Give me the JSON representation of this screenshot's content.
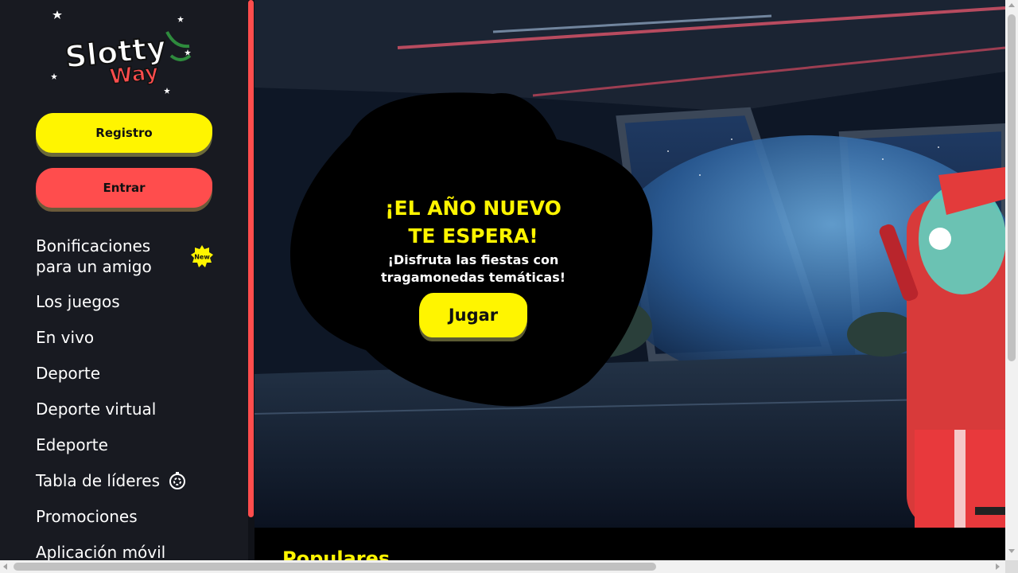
{
  "brand": {
    "line1": "Slotty",
    "line2": "Way"
  },
  "auth": {
    "register_label": "Registro",
    "login_label": "Entrar"
  },
  "nav": {
    "items": [
      {
        "label": "Bonificaciones\npara un amigo",
        "badge": "New"
      },
      {
        "label": "Los juegos"
      },
      {
        "label": "En vivo"
      },
      {
        "label": "Deporte"
      },
      {
        "label": "Deporte virtual"
      },
      {
        "label": "Edeporte"
      },
      {
        "label": "Tabla de líderes",
        "icon": "timer-icon"
      },
      {
        "label": "Promociones"
      },
      {
        "label": "Aplicación móvil"
      }
    ]
  },
  "hero": {
    "title": "¡EL AÑO NUEVO\nTE ESPERA!",
    "subtitle": "¡Disfruta las fiestas con\ntragamonedas temáticas!",
    "cta_label": "Jugar"
  },
  "sections": {
    "popular_title": "Populares"
  },
  "colors": {
    "accent_yellow": "#fff500",
    "accent_red": "#ff4d4d",
    "sidebar_bg": "#181a21"
  }
}
